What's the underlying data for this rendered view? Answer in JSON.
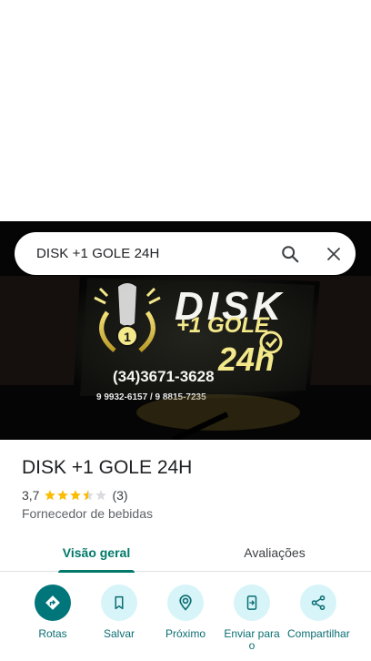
{
  "search": {
    "query": "DISK +1 GOLE 24H"
  },
  "hero_photo": {
    "sign_title": "DISK",
    "sign_subtitle": "+1 GOLE",
    "sign_phone": "(34)3671-3628",
    "sign_phone_2": "9 9932-6157 / 9 8815-7235",
    "sign_hours": "24h",
    "badge_number": "1"
  },
  "place": {
    "name": "DISK +1 GOLE 24H",
    "rating": "3,7",
    "rating_value": 3.7,
    "review_count": "(3)",
    "category": "Fornecedor de bebidas"
  },
  "tabs": [
    {
      "label": "Visão geral",
      "selected": true
    },
    {
      "label": "Avaliações",
      "selected": false
    }
  ],
  "actions": [
    {
      "label": "Rotas",
      "icon": "directions-icon"
    },
    {
      "label": "Salvar",
      "icon": "bookmark-icon"
    },
    {
      "label": "Próximo",
      "icon": "nearby-icon"
    },
    {
      "label": "Enviar para o",
      "icon": "send-to-phone-icon"
    },
    {
      "label": "Compartilhar",
      "icon": "share-icon"
    }
  ],
  "colors": {
    "accent": "#00796b",
    "action_bg": "#d7f4f8",
    "action_primary": "#00767b",
    "star": "#fbbc04"
  }
}
